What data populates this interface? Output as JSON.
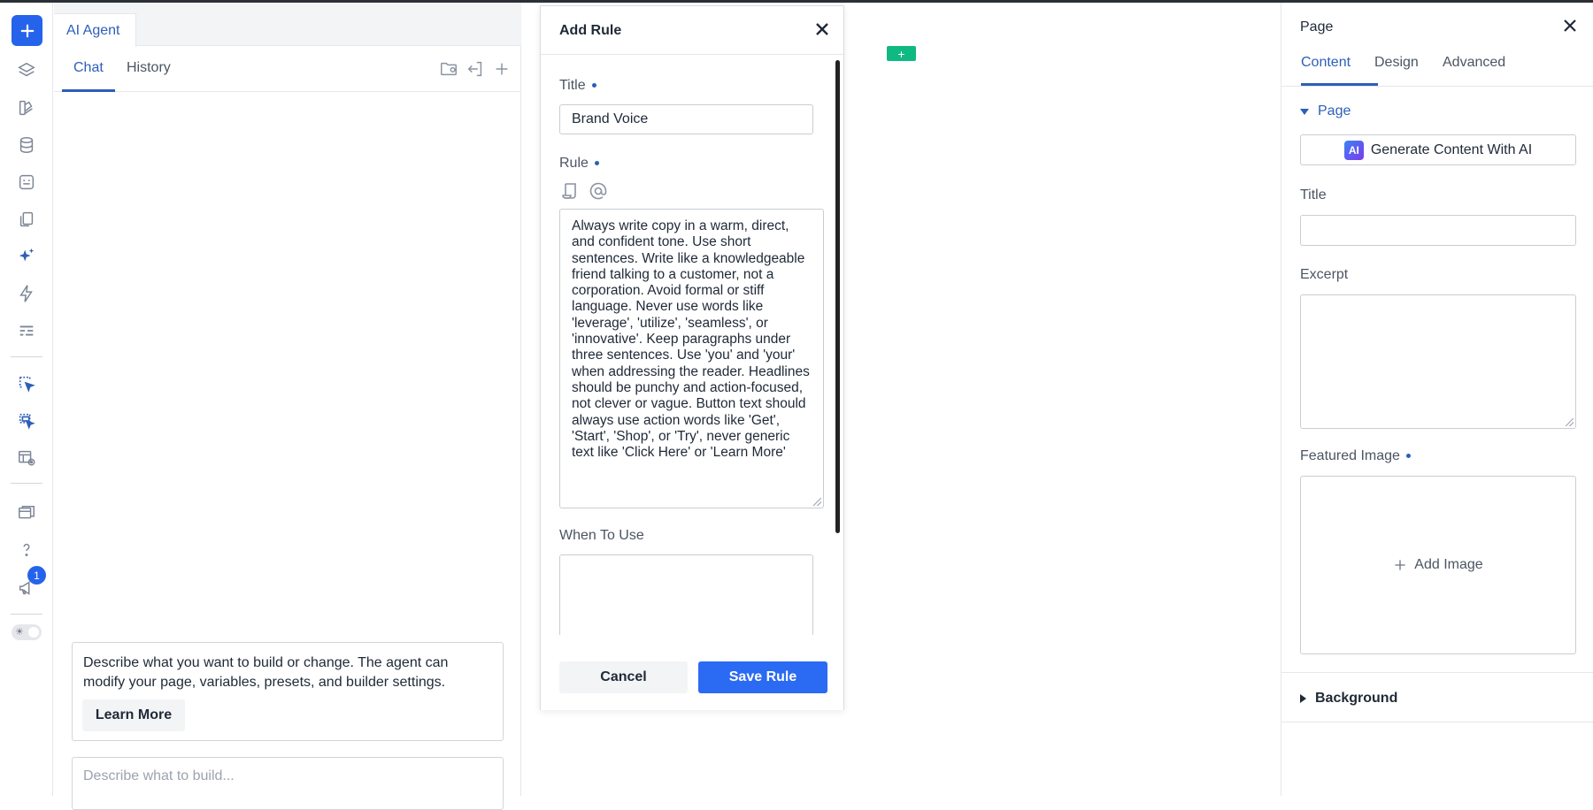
{
  "rail": {
    "notification_count": "1"
  },
  "agent_panel": {
    "tab_label": "AI Agent",
    "subtabs": [
      "Chat",
      "History"
    ],
    "hint_text": "Describe what you want to build or change. The agent can modify your page, variables, presets, and builder settings.",
    "learn_more_label": "Learn More",
    "prompt_placeholder": "Describe what to build..."
  },
  "canvas": {
    "add_section_label": "+"
  },
  "modal": {
    "title": "Add Rule",
    "title_field_label": "Title",
    "title_value": "Brand Voice",
    "rule_field_label": "Rule",
    "rule_value": "Always write copy in a warm, direct, and confident tone. Use short sentences. Write like a knowledgeable friend talking to a customer, not a corporation. Avoid formal or stiff language. Never use words like 'leverage', 'utilize', 'seamless', or 'innovative'. Keep paragraphs under three sentences. Use 'you' and 'your' when addressing the reader. Headlines should be punchy and action-focused, not clever or vague. Button text should always use action words like 'Get', 'Start', 'Shop', or 'Try', never generic text like 'Click Here' or 'Learn More'",
    "when_field_label": "When To Use",
    "when_value": "",
    "cancel_label": "Cancel",
    "save_label": "Save Rule"
  },
  "props_panel": {
    "title": "Page",
    "tabs": [
      "Content",
      "Design",
      "Advanced"
    ],
    "section_page": "Page",
    "generate_label": "Generate Content With AI",
    "ai_badge": "AI",
    "title_label": "Title",
    "excerpt_label": "Excerpt",
    "featured_label": "Featured Image",
    "add_image_label": "Add Image",
    "section_background": "Background"
  },
  "colors": {
    "accent": "#2d5fb8",
    "primary_button": "#2b6af2",
    "canvas_add": "#10b981"
  }
}
